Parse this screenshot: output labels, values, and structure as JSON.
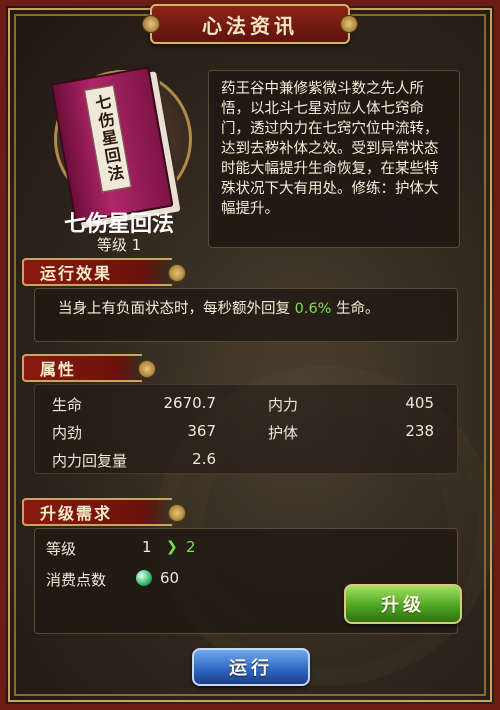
{
  "window": {
    "title": "心法资讯"
  },
  "skill": {
    "book_label": "七伤星回法",
    "name": "七伤星回法",
    "level_text": "等级 1",
    "description": "药王谷中兼修紫微斗数之先人所悟，以北斗七星对应人体七窍命门，透过内力在七窍穴位中流转，达到去秽补体之效。受到异常状态时能大幅提升生命恢复，在某些特殊状况下大有用处。修练：护体大幅提升。"
  },
  "effect": {
    "header": "运行效果",
    "text_before": "当身上有负面状态时，每秒额外回复 ",
    "percent": "0.6%",
    "text_after": " 生命。"
  },
  "attributes": {
    "header": "属性",
    "items": [
      {
        "label": "生命",
        "value": "2670.7"
      },
      {
        "label": "内力",
        "value": "405"
      },
      {
        "label": "内劲",
        "value": "367"
      },
      {
        "label": "护体",
        "value": "238"
      },
      {
        "label": "内力回复量",
        "value": "2.6"
      }
    ]
  },
  "upgrade": {
    "header": "升级需求",
    "level_label": "等级",
    "level_current": "1",
    "level_next": "2",
    "cost_label": "消费点数",
    "cost_value": "60",
    "button_label": "升级"
  },
  "actions": {
    "run_label": "运行"
  },
  "colors": {
    "frame": "#6b1c14",
    "gold_trim": "#c9a45a",
    "highlight_green": "#7ee04a",
    "upgrade_button": "#4aa020",
    "run_button": "#2e64c0"
  }
}
